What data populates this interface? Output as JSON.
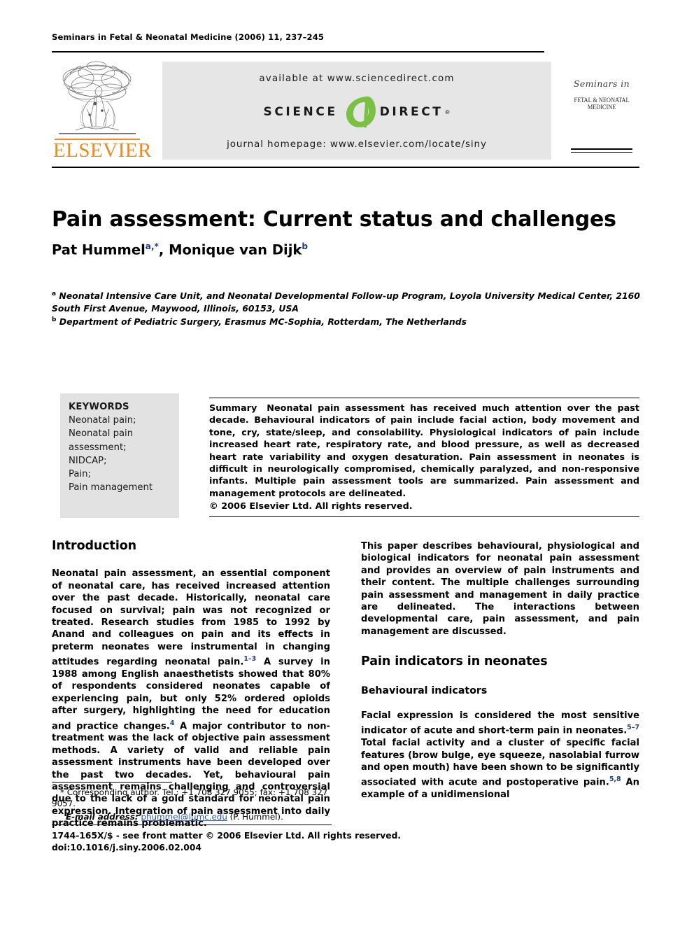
{
  "running_head": "Seminars in Fetal & Neonatal Medicine (2006) 11, 237–245",
  "masthead": {
    "publisher_name": "ELSEVIER",
    "available_at": "available at www.sciencedirect.com",
    "logo_science": "SCIENCE",
    "logo_direct": "DIRECT",
    "logo_registered": "®",
    "journal_homepage": "journal homepage: www.elsevier.com/locate/siny",
    "cover_script": "Seminars in",
    "cover_title": "FETAL & NEONATAL MEDICINE",
    "elsevier_orange": "#f08a1c",
    "sciencedirect_green": "#7ac143",
    "banner_bg": "#e6e6e6"
  },
  "article": {
    "title": "Pain assessment: Current status and challenges",
    "authors": [
      {
        "name": "Pat Hummel",
        "marks": "a,*"
      },
      {
        "name": "Monique van Dijk",
        "marks": "b"
      }
    ],
    "affiliations": [
      {
        "mark": "a",
        "text": "Neonatal Intensive Care Unit, and Neonatal Developmental Follow-up Program, Loyola University Medical Center, 2160 South First Avenue, Maywood, Illinois, 60153, USA"
      },
      {
        "mark": "b",
        "text": "Department of Pediatric Surgery, Erasmus MC-Sophia, Rotterdam, The Netherlands"
      }
    ]
  },
  "keywords": {
    "heading": "KEYWORDS",
    "items": [
      "Neonatal pain;",
      "Neonatal pain",
      "assessment;",
      "NIDCAP;",
      "Pain;",
      "Pain management"
    ]
  },
  "abstract": {
    "heading": "Summary",
    "text": "Neonatal pain assessment has received much attention over the past decade. Behavioural indicators of pain include facial action, body movement and tone, cry, state/sleep, and consolability. Physiological indicators of pain include increased heart rate, respiratory rate, and blood pressure, as well as decreased heart rate variability and oxygen desaturation. Pain assessment in neonates is difficult in neurologically compromised, chemically paralyzed, and non-responsive infants. Multiple pain assessment tools are summarized. Pain assessment and management protocols are delineated.",
    "copyright": "© 2006 Elsevier Ltd. All rights reserved."
  },
  "body": {
    "intro_heading": "Introduction",
    "intro_p1_a": "Neonatal pain assessment, an essential component of neonatal care, has received increased attention over the past decade. Historically, neonatal care focused on survival; pain was not recognized or treated. Research studies from 1985 to 1992 by Anand and colleagues on pain and its effects in preterm neonates were instrumental in changing attitudes regarding neonatal pain.",
    "intro_p1_ref1": "1–3",
    "intro_p1_b": " A survey in 1988 among English anaesthetists showed that 80% of respondents considered neonates capable of experiencing pain, but only 52% ordered opioids after surgery, highlighting the need for education and practice changes.",
    "intro_p1_ref2": "4",
    "intro_p1_c": " A major contributor to non-treatment was the lack of objective pain assessment methods. A variety of valid and reliable pain assessment instruments have been developed over the past two decades. Yet, behavioural pain assessment remains challenging and controversial due to the lack of a gold standard for neonatal pain expression. Integration of pain assessment into daily practice remains problematic.",
    "intro_p2": "This paper describes behavioural, physiological and biological indicators for neonatal pain assessment and provides an overview of pain instruments and their content. The multiple challenges surrounding pain assessment and management in daily practice are delineated. The interactions between developmental care, pain assessment, and pain management are discussed.",
    "sec2_heading": "Pain indicators in neonates",
    "sub1_heading": "Behavioural indicators",
    "sub1_p_a": "Facial expression is considered the most sensitive indicator of acute and short-term pain in neonates.",
    "sub1_p_ref1": "5–7",
    "sub1_p_b": " Total facial activity and a cluster of specific facial features (brow bulge, eye squeeze, nasolabial furrow and open mouth) have been shown to be significantly associated with acute and postoperative pain.",
    "sub1_p_ref2": "5,8",
    "sub1_p_c": " An example of a unidimensional"
  },
  "footnote": {
    "corresponding": "* Corresponding author. Tel.: +1 708 327 9055; fax: +1 708 327 9057.",
    "email_label": "E-mail address:",
    "email": "phummel@lumc.edu",
    "email_suffix": "(P. Hummel)."
  },
  "bottom": {
    "front_matter": "1744-165X/$ - see front matter © 2006 Elsevier Ltd. All rights reserved.",
    "doi": "doi:10.1016/j.siny.2006.02.004"
  }
}
